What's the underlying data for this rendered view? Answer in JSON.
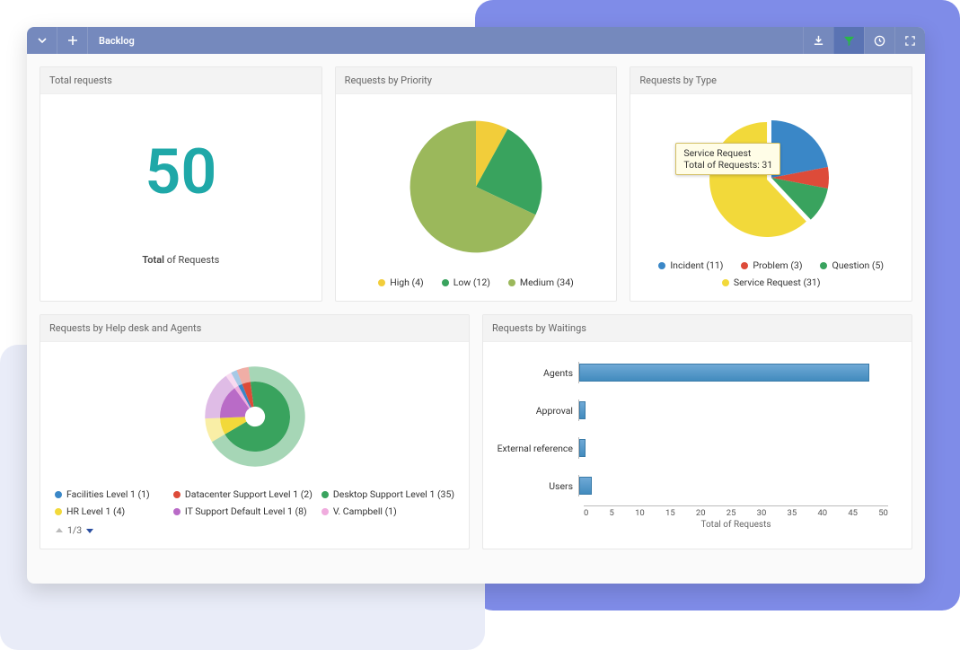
{
  "toolbar": {
    "title": "Backlog",
    "icons": {
      "chevron": "chevron-down-icon",
      "plus": "plus-icon",
      "download": "download-icon",
      "filter": "filter-icon",
      "clock": "clock-icon",
      "fullscreen": "fullscreen-icon"
    }
  },
  "cards": {
    "total": {
      "title": "Total requests",
      "value": "50",
      "label_prefix": "Total",
      "label_suffix": " of Requests"
    },
    "priority": {
      "title": "Requests by Priority"
    },
    "type": {
      "title": "Requests by Type",
      "tooltip": {
        "line1": "Service Request",
        "line2": "Total of Requests: 31"
      }
    },
    "helpdesk": {
      "title": "Requests by Help desk and Agents",
      "pager": "1/3"
    },
    "waitings": {
      "title": "Requests by Waitings",
      "xlabel": "Total of Requests"
    }
  },
  "chart_data": [
    {
      "id": "priority",
      "type": "pie",
      "title": "Requests by Priority",
      "series": [
        {
          "name": "High",
          "value": 4,
          "label": "High (4)",
          "color": "#f2cd3a"
        },
        {
          "name": "Low",
          "value": 12,
          "label": "Low (12)",
          "color": "#39a35e"
        },
        {
          "name": "Medium",
          "value": 34,
          "label": "Medium (34)",
          "color": "#9bb85b"
        }
      ]
    },
    {
      "id": "type",
      "type": "pie",
      "title": "Requests by Type",
      "highlighted": "Service Request",
      "series": [
        {
          "name": "Incident",
          "value": 11,
          "label": "Incident (11)",
          "color": "#3a87c7"
        },
        {
          "name": "Problem",
          "value": 3,
          "label": "Problem (3)",
          "color": "#dd4b39"
        },
        {
          "name": "Question",
          "value": 5,
          "label": "Question (5)",
          "color": "#39a35e"
        },
        {
          "name": "Service Request",
          "value": 31,
          "label": "Service Request (31)",
          "color": "#f2d93a"
        }
      ]
    },
    {
      "id": "helpdesk",
      "type": "pie",
      "title": "Requests by Help desk and Agents",
      "series": [
        {
          "name": "Facilities Level 1",
          "value": 1,
          "label": "Facilities Level 1 (1)",
          "color": "#3a87c7"
        },
        {
          "name": "Datacenter Support Level 1",
          "value": 2,
          "label": "Datacenter Support Level 1 (2)",
          "color": "#dd4b39"
        },
        {
          "name": "Desktop Support Level 1",
          "value": 35,
          "label": "Desktop Support Level 1 (35)",
          "color": "#39a35e"
        },
        {
          "name": "HR Level 1",
          "value": 4,
          "label": "HR Level 1 (4)",
          "color": "#f2d93a"
        },
        {
          "name": "IT Support Default Level 1",
          "value": 8,
          "label": "IT Support Default Level 1 (8)",
          "color": "#b96bc7"
        },
        {
          "name": "V. Campbell",
          "value": 1,
          "label": "V. Campbell (1)",
          "color": "#f0acde"
        }
      ]
    },
    {
      "id": "waitings",
      "type": "bar",
      "title": "Requests by Waitings",
      "xlabel": "Total of Requests",
      "xlim": [
        0,
        50
      ],
      "xticks": [
        0,
        5,
        10,
        15,
        20,
        25,
        30,
        35,
        40,
        45,
        50
      ],
      "categories": [
        "Agents",
        "Approval",
        "External reference",
        "Users"
      ],
      "values": [
        47,
        1,
        1,
        2
      ]
    }
  ]
}
